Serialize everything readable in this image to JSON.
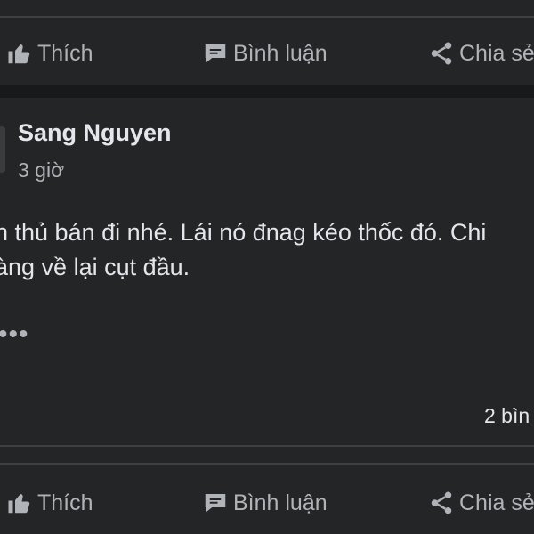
{
  "actions_top": {
    "like_label": "Thích",
    "comment_label": "Bình luận",
    "share_label": "Chia sẻ"
  },
  "post": {
    "author": "Sang Nguyen",
    "time": "3 giờ",
    "text_lines": [
      "n thủ bán đi nhé. Lái nó đnag kéo thốc đó. Chi",
      "àng về lại cụt đầu."
    ],
    "more_label": "•••",
    "comment_count": "2 bìn"
  },
  "actions_bottom": {
    "like_label": "Thích",
    "comment_label": "Bình luận",
    "share_label": "Chia sẻ"
  },
  "colors": {
    "background": "#242526",
    "separator": "#18191a",
    "divider": "#3e4042",
    "primary_text": "#e4e6eb",
    "secondary_text": "#b0b3b8"
  },
  "icons": {
    "like": "thumbs-up-icon",
    "comment": "speech-bubble-icon",
    "share": "share-icon"
  }
}
